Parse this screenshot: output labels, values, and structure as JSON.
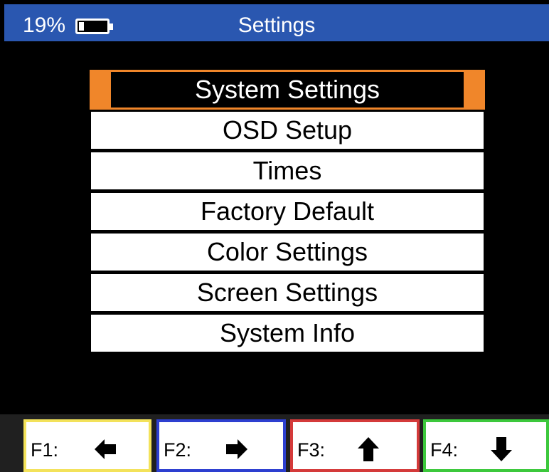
{
  "status": {
    "battery_text": "19%",
    "battery_level": 0.19,
    "title": "Settings",
    "bar_color": "#2a57b0"
  },
  "menu": {
    "selected_index": 0,
    "accent_color": "#f0862a",
    "items": [
      {
        "label": "System Settings"
      },
      {
        "label": "OSD Setup"
      },
      {
        "label": "Times"
      },
      {
        "label": "Factory Default"
      },
      {
        "label": "Color Settings"
      },
      {
        "label": "Screen Settings"
      },
      {
        "label": "System Info"
      }
    ]
  },
  "function_keys": [
    {
      "label": "F1:",
      "icon": "arrow-left-icon",
      "color": "#f3e25a"
    },
    {
      "label": "F2:",
      "icon": "arrow-right-icon",
      "color": "#2d3fd0"
    },
    {
      "label": "F3:",
      "icon": "arrow-up-icon",
      "color": "#d43a3a"
    },
    {
      "label": "F4:",
      "icon": "arrow-down-icon",
      "color": "#3cc83c"
    }
  ]
}
